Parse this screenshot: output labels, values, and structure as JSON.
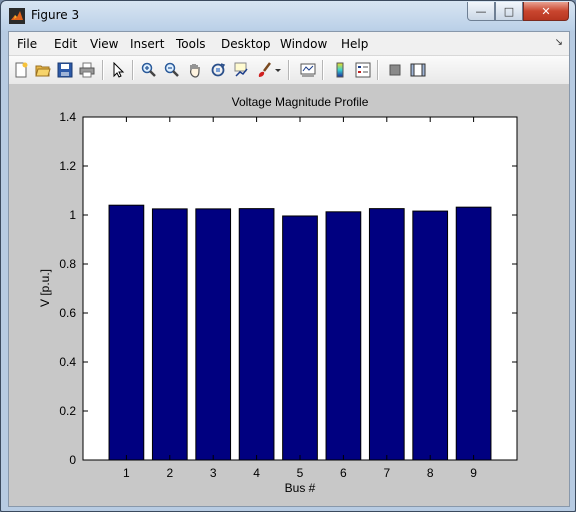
{
  "window": {
    "title": "Figure 3"
  },
  "menu": {
    "file": "File",
    "edit": "Edit",
    "view": "View",
    "insert": "Insert",
    "tools": "Tools",
    "desktop": "Desktop",
    "window": "Window",
    "help": "Help"
  },
  "toolbar": {
    "icons": [
      "new-figure-icon",
      "open-file-icon",
      "save-icon",
      "print-icon",
      "edit-plot-arrow-icon",
      "zoom-in-icon",
      "zoom-out-icon",
      "pan-hand-icon",
      "rotate-3d-icon",
      "data-cursor-icon",
      "brush-icon",
      "brush-dropdown-icon",
      "link-plot-icon",
      "colorbar-icon",
      "legend-icon",
      "hide-plot-tools-icon",
      "show-plot-tools-icon"
    ]
  },
  "colors": {
    "bar_fill": "#000080",
    "figure_bg": "#c8c8c8",
    "axes_bg": "#ffffff"
  },
  "chart_data": {
    "type": "bar",
    "title": "Voltage Magnitude Profile",
    "xlabel": "Bus #",
    "ylabel": "V [p.u.]",
    "categories": [
      "1",
      "2",
      "3",
      "4",
      "5",
      "6",
      "7",
      "8",
      "9"
    ],
    "values": [
      1.04,
      1.025,
      1.025,
      1.026,
      0.996,
      1.013,
      1.026,
      1.016,
      1.032
    ],
    "ylim": [
      0,
      1.4
    ],
    "yticks": [
      "0",
      "0.2",
      "0.4",
      "0.6",
      "0.8",
      "1",
      "1.2",
      "1.4"
    ],
    "grid": false
  }
}
